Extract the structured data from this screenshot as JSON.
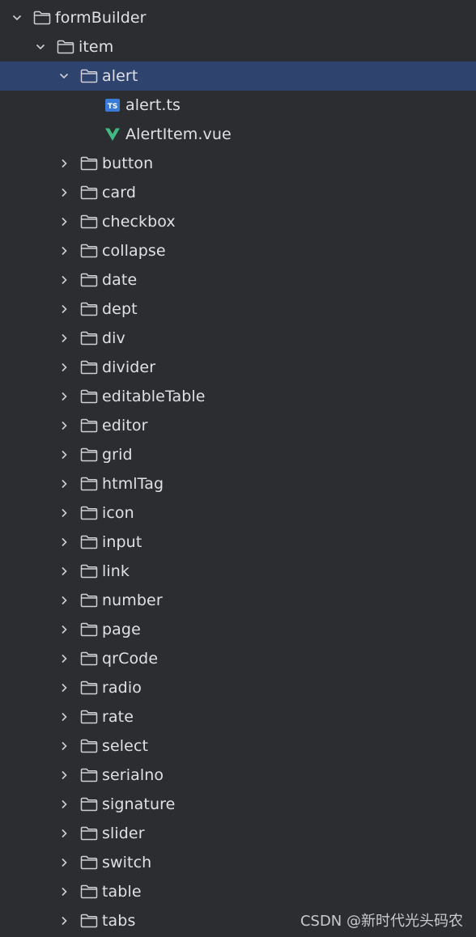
{
  "colors": {
    "background": "#2b2d30",
    "selection": "#2e436e",
    "text": "#dfe1e5",
    "icon": "#ced0d6",
    "ts_badge": "#3a7bd5",
    "vue_green": "#42b883"
  },
  "tree": {
    "root": {
      "label": "formBuilder",
      "icon": "folder-icon",
      "expanded": true
    },
    "item": {
      "label": "item",
      "icon": "folder-icon",
      "expanded": true
    },
    "alert": {
      "label": "alert",
      "icon": "folder-icon",
      "expanded": true,
      "selected": true,
      "files": [
        {
          "label": "alert.ts",
          "icon": "typescript-file-icon",
          "badge": "TS"
        },
        {
          "label": "AlertItem.vue",
          "icon": "vue-file-icon"
        }
      ]
    },
    "folders": [
      "button",
      "card",
      "checkbox",
      "collapse",
      "date",
      "dept",
      "div",
      "divider",
      "editableTable",
      "editor",
      "grid",
      "htmlTag",
      "icon",
      "input",
      "link",
      "number",
      "page",
      "qrCode",
      "radio",
      "rate",
      "select",
      "serialno",
      "signature",
      "slider",
      "switch",
      "table",
      "tabs"
    ]
  },
  "watermark": "CSDN @新时代光头码农"
}
